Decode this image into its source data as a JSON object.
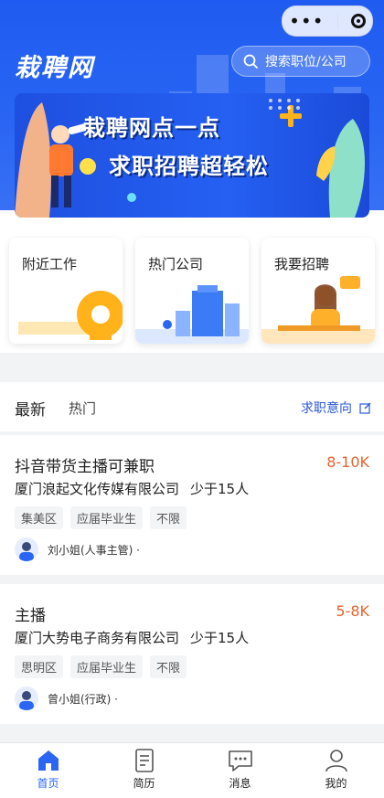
{
  "app": {
    "logo": "栽聘网"
  },
  "search": {
    "placeholder": "搜索职位/公司"
  },
  "banner": {
    "line1": "栽聘网点一点",
    "line2": "求职招聘超轻松"
  },
  "quick_links": [
    {
      "label": "附近工作"
    },
    {
      "label": "热门公司"
    },
    {
      "label": "我要招聘"
    }
  ],
  "tabs": {
    "latest": "最新",
    "hot": "热门",
    "intent": "求职意向"
  },
  "jobs": [
    {
      "title": "抖音带货主播可兼职",
      "salary": "8-10K",
      "company": "厦门浪起文化传媒有限公司",
      "size": "少于15人",
      "tags": [
        "集美区",
        "应届毕业生",
        "不限"
      ],
      "recruiter": "刘小姐(人事主管)  ·"
    },
    {
      "title": "主播",
      "salary": "5-8K",
      "company": "厦门大势电子商务有限公司",
      "size": "少于15人",
      "tags": [
        "思明区",
        "应届毕业生",
        "不限"
      ],
      "recruiter": "曾小姐(行政)  ·"
    }
  ],
  "nav": [
    {
      "label": "首页",
      "icon": "home-icon",
      "active": true
    },
    {
      "label": "简历",
      "icon": "resume-icon"
    },
    {
      "label": "消息",
      "icon": "message-icon"
    },
    {
      "label": "我的",
      "icon": "profile-icon"
    }
  ],
  "colors": {
    "brand": "#2a66f3",
    "salary": "#e4642f",
    "link": "#2a58d8"
  }
}
